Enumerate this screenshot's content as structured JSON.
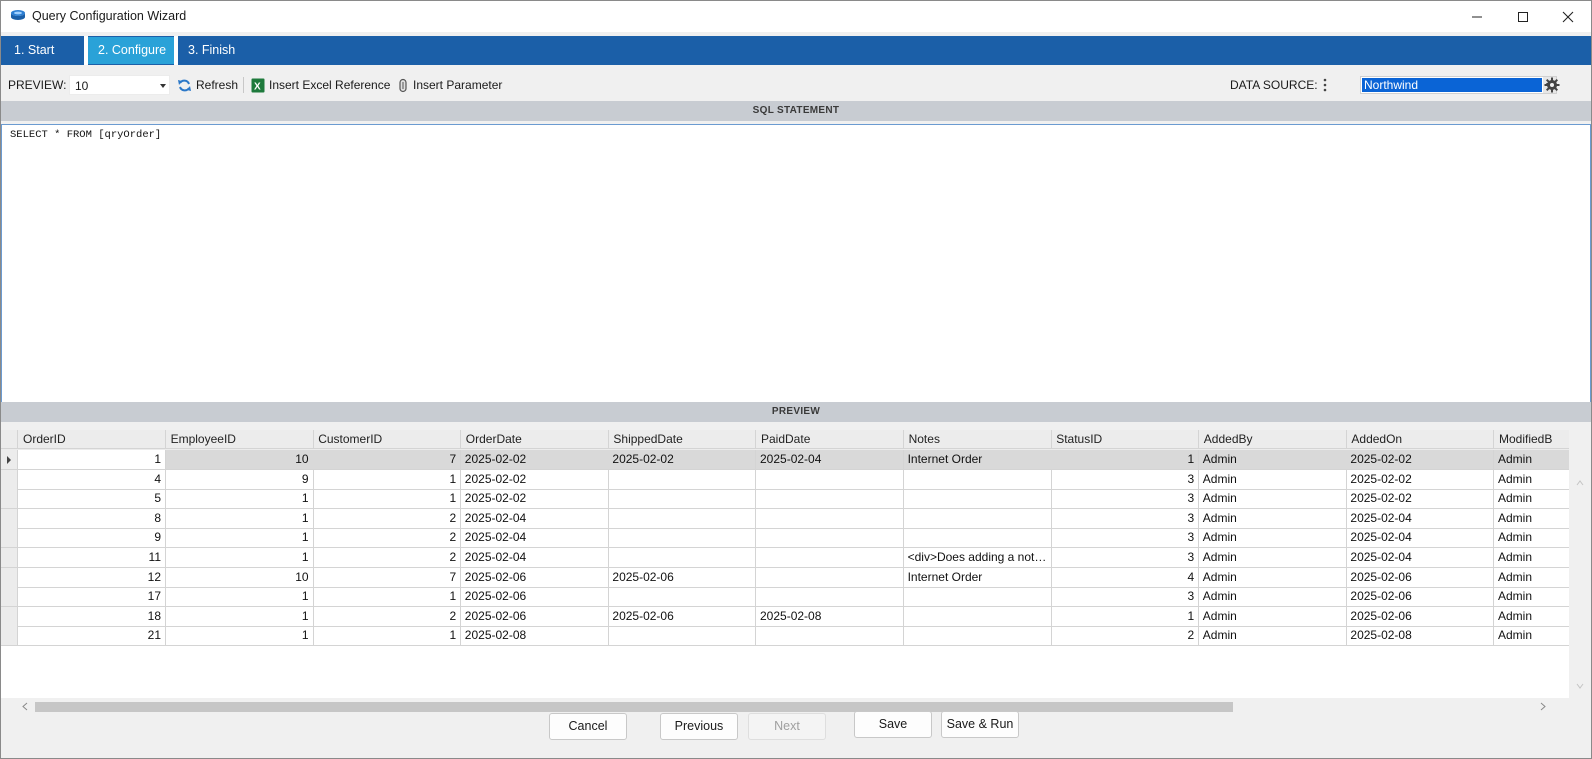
{
  "window": {
    "title": "Query Configuration Wizard"
  },
  "tabs": [
    {
      "label": "1. Start",
      "active": false
    },
    {
      "label": "2. Configure",
      "active": true
    },
    {
      "label": "3. Finish",
      "active": false
    }
  ],
  "toolbar": {
    "preview_label": "PREVIEW:",
    "preview_value": "10",
    "refresh_label": "Refresh",
    "insert_excel_label": "Insert Excel Reference",
    "insert_param_label": "Insert Parameter",
    "datasource_label": "DATA SOURCE:",
    "datasource_value": "Northwind"
  },
  "sql": {
    "header": "SQL STATEMENT",
    "text": "SELECT * FROM [qryOrder]"
  },
  "preview": {
    "header": "PREVIEW",
    "columns": [
      "OrderID",
      "EmployeeID",
      "CustomerID",
      "OrderDate",
      "ShippedDate",
      "PaidDate",
      "Notes",
      "StatusID",
      "AddedBy",
      "AddedOn",
      "ModifiedB"
    ],
    "rows": [
      [
        "1",
        "10",
        "7",
        "2025-02-02",
        "2025-02-02",
        "2025-02-04",
        "Internet Order",
        "1",
        "Admin",
        "2025-02-02",
        "Admin"
      ],
      [
        "4",
        "9",
        "1",
        "2025-02-02",
        "",
        "",
        "",
        "3",
        "Admin",
        "2025-02-02",
        "Admin"
      ],
      [
        "5",
        "1",
        "1",
        "2025-02-02",
        "",
        "",
        "",
        "3",
        "Admin",
        "2025-02-02",
        "Admin"
      ],
      [
        "8",
        "1",
        "2",
        "2025-02-04",
        "",
        "",
        "",
        "3",
        "Admin",
        "2025-02-04",
        "Admin"
      ],
      [
        "9",
        "1",
        "2",
        "2025-02-04",
        "",
        "",
        "",
        "3",
        "Admin",
        "2025-02-04",
        "Admin"
      ],
      [
        "11",
        "1",
        "2",
        "2025-02-04",
        "",
        "",
        "<div>Does adding a note work?</div>",
        "3",
        "Admin",
        "2025-02-04",
        "Admin"
      ],
      [
        "12",
        "10",
        "7",
        "2025-02-06",
        "2025-02-06",
        "",
        "Internet Order",
        "4",
        "Admin",
        "2025-02-06",
        "Admin"
      ],
      [
        "17",
        "1",
        "1",
        "2025-02-06",
        "",
        "",
        "",
        "3",
        "Admin",
        "2025-02-06",
        "Admin"
      ],
      [
        "18",
        "1",
        "2",
        "2025-02-06",
        "2025-02-06",
        "2025-02-08",
        "",
        "1",
        "Admin",
        "2025-02-06",
        "Admin"
      ],
      [
        "21",
        "1",
        "1",
        "2025-02-08",
        "",
        "",
        "",
        "2",
        "Admin",
        "2025-02-08",
        "Admin"
      ]
    ],
    "selected_row": 0
  },
  "footer": {
    "cancel": "Cancel",
    "previous": "Previous",
    "next": "Next",
    "save": "Save",
    "save_run": "Save & Run"
  }
}
